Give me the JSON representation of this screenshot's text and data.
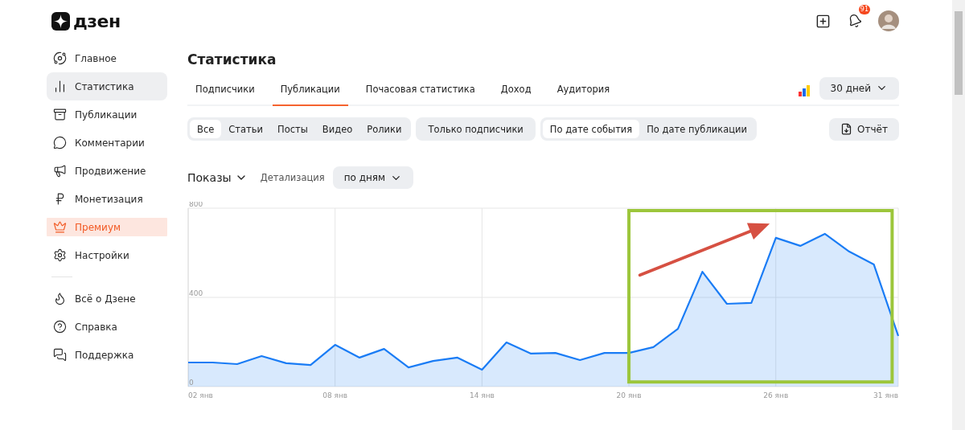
{
  "header": {
    "logo": "дзен",
    "notifications": "91"
  },
  "sidebar": {
    "items": [
      {
        "label": "Главное",
        "kind": "regular",
        "selected": false
      },
      {
        "label": "Статистика",
        "kind": "regular",
        "selected": true
      },
      {
        "label": "Публикации",
        "kind": "regular",
        "selected": false
      },
      {
        "label": "Комментарии",
        "kind": "regular",
        "selected": false
      },
      {
        "label": "Продвижение",
        "kind": "regular",
        "selected": false
      },
      {
        "label": "Монетизация",
        "kind": "regular",
        "selected": false
      },
      {
        "label": "Премиум",
        "kind": "premium",
        "selected": false
      },
      {
        "label": "Настройки",
        "kind": "regular",
        "selected": false
      }
    ],
    "footer_items": [
      {
        "label": "Всё о Дзене"
      },
      {
        "label": "Справка"
      },
      {
        "label": "Поддержка"
      }
    ]
  },
  "page": {
    "title": "Статистика",
    "tabs": [
      {
        "label": "Подписчики",
        "selected": false
      },
      {
        "label": "Публикации",
        "selected": true
      },
      {
        "label": "Почасовая статистика",
        "selected": false
      },
      {
        "label": "Доход",
        "selected": false
      },
      {
        "label": "Аудитория",
        "selected": false
      }
    ],
    "period": "30 дней",
    "content_filters": [
      {
        "label": "Все",
        "selected": true
      },
      {
        "label": "Статьи",
        "selected": false
      },
      {
        "label": "Посты",
        "selected": false
      },
      {
        "label": "Видео",
        "selected": false
      },
      {
        "label": "Ролики",
        "selected": false
      }
    ],
    "subscribers_only": {
      "label": "Только подписчики",
      "selected": false
    },
    "date_filters": [
      {
        "label": "По дате события",
        "selected": true
      },
      {
        "label": "По дате публикации",
        "selected": false
      }
    ],
    "report_button": "Отчёт",
    "metric": "Показы",
    "detail_label": "Детализация",
    "detail_value": "по дням"
  },
  "chart_data": {
    "type": "area",
    "x": [
      2,
      3,
      4,
      5,
      6,
      7,
      8,
      9,
      10,
      11,
      12,
      13,
      14,
      15,
      16,
      17,
      18,
      19,
      20,
      21,
      22,
      23,
      24,
      25,
      26,
      27,
      28,
      29,
      30,
      31
    ],
    "series": [
      {
        "color": "#1a7cf5",
        "values": [
          108,
          108,
          101,
          137,
          105,
          97,
          187,
          130,
          169,
          86,
          115,
          130,
          76,
          198,
          148,
          151,
          119,
          151,
          151,
          177,
          259,
          515,
          371,
          375,
          667,
          631,
          685,
          605,
          548,
          227
        ]
      }
    ],
    "xlim": [
      2,
      31
    ],
    "ylim": [
      0,
      800
    ],
    "xticks": [
      {
        "value": 2,
        "label": "02 янв"
      },
      {
        "value": 8,
        "label": "08 янв"
      },
      {
        "value": 14,
        "label": "14 янв"
      },
      {
        "value": 20,
        "label": "20 янв"
      },
      {
        "value": 26,
        "label": "26 янв"
      },
      {
        "value": 31,
        "label": "31 янв"
      }
    ],
    "yticks": [
      0,
      400,
      800
    ],
    "grid": true
  },
  "overlays": [
    {
      "kind": "frame",
      "color": "#9cc63b"
    },
    {
      "kind": "arrow",
      "color": "#d65042"
    }
  ]
}
